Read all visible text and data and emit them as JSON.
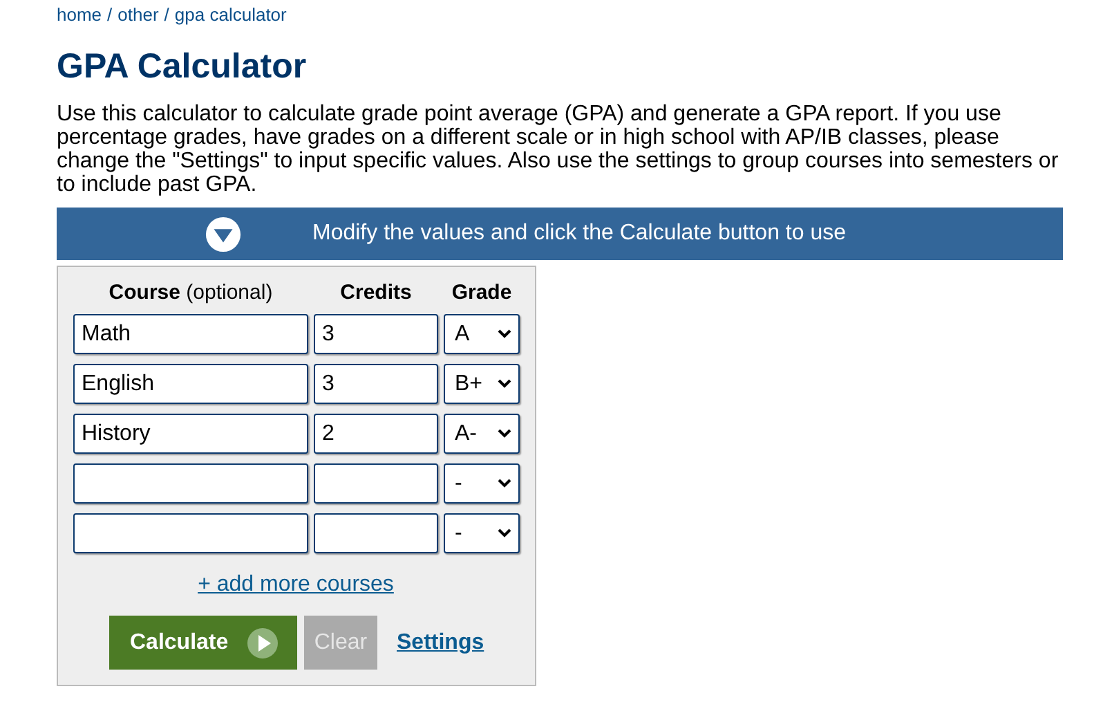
{
  "breadcrumb": [
    "home",
    "/",
    "other",
    "/",
    "gpa calculator"
  ],
  "title": "GPA Calculator",
  "intro": "Use this calculator to calculate grade point average (GPA) and generate a GPA report. If you use percentage grades, have grades on a different scale or in high school with AP/IB classes, please change the \"Settings\" to input specific values. Also use the settings to group courses into semesters or to include past GPA.",
  "banner": "Modify the values and click the Calculate button to use",
  "columns": [
    "**Course** (optional)",
    "Credits",
    "Grade"
  ],
  "courses": [
    {
      "course": "Math",
      "credits": "3",
      "grade": "A"
    },
    {
      "course": "English",
      "credits": "3",
      "grade": "B+"
    },
    {
      "course": "History",
      "credits": "2",
      "grade": "A-"
    },
    {
      "grade": "-"
    },
    {
      "grade": "-"
    }
  ],
  "add_link": "+ add more courses",
  "buttons": {
    "calculate": "Calculate",
    "clear": "Clear",
    "settings": "Settings"
  }
}
